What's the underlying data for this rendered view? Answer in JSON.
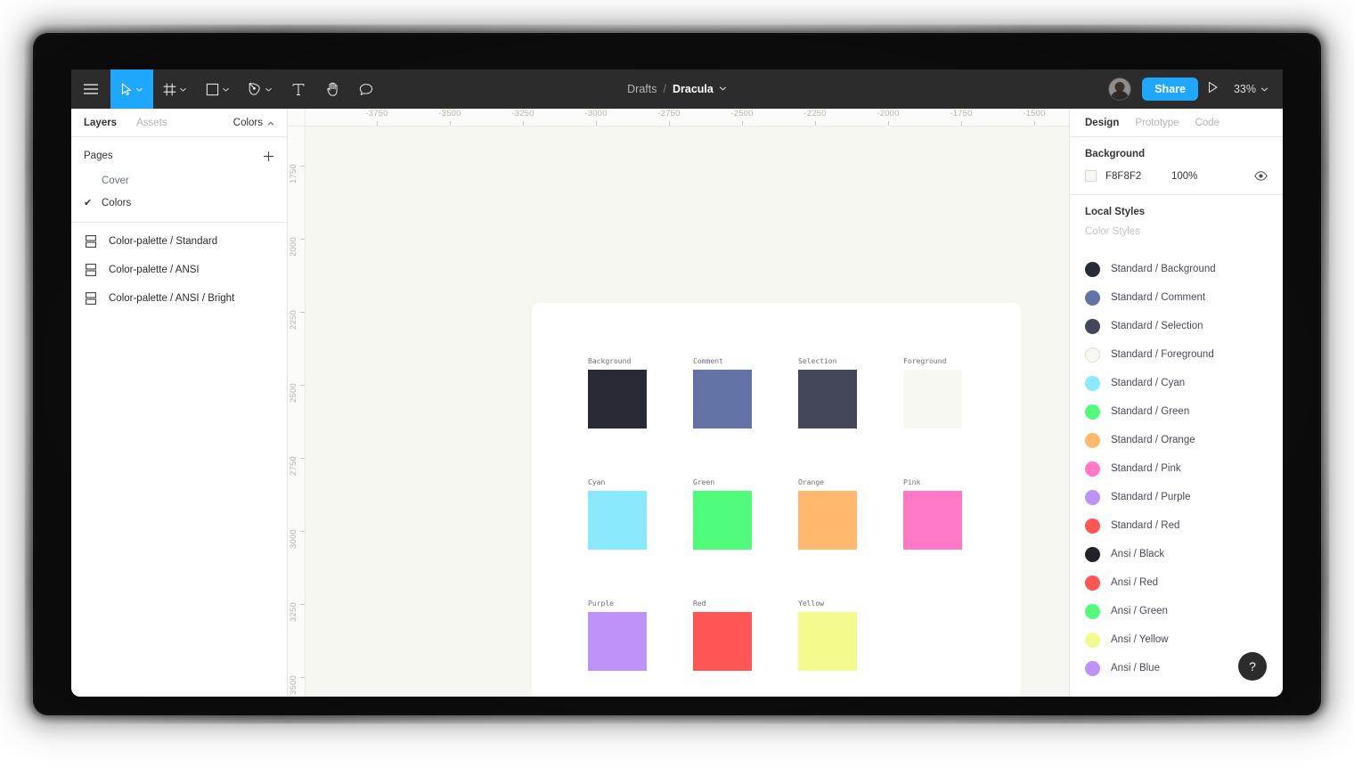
{
  "app": {
    "zoom_level": "33%"
  },
  "toolbar": {
    "menu_icon": "hamburger-menu-icon",
    "tools": [
      {
        "name": "move-tool",
        "icon": "cursor-arrow-icon",
        "has_caret": true,
        "active": true
      },
      {
        "name": "frame-tool",
        "icon": "frame-grid-icon",
        "has_caret": true,
        "active": false
      },
      {
        "name": "shape-tool",
        "icon": "square-icon",
        "has_caret": true,
        "active": false
      },
      {
        "name": "pen-tool",
        "icon": "pen-nib-icon",
        "has_caret": true,
        "active": false
      },
      {
        "name": "text-tool",
        "icon": "text-t-icon",
        "has_caret": false,
        "active": false
      },
      {
        "name": "hand-tool",
        "icon": "hand-icon",
        "has_caret": false,
        "active": false
      },
      {
        "name": "comment-tool",
        "icon": "comment-bubble-icon",
        "has_caret": false,
        "active": false
      }
    ],
    "breadcrumb": {
      "parent": "Drafts",
      "separator": "/",
      "file": "Dracula",
      "caret": "⌄"
    },
    "share_label": "Share",
    "present_icon": "play-triangle-icon",
    "avatar_name": "user-avatar"
  },
  "left_panel": {
    "tabs": [
      {
        "label": "Layers",
        "active": true
      },
      {
        "label": "Assets",
        "active": false
      }
    ],
    "right_tab": {
      "label": "Colors",
      "icon": "chevron-up-icon"
    },
    "pages_title": "Pages",
    "add_page_icon": "plus-icon",
    "pages": [
      {
        "label": "Cover",
        "selected": false,
        "tick": ""
      },
      {
        "label": "Colors",
        "selected": true,
        "tick": "✔"
      }
    ],
    "layers": [
      {
        "label": "Color-palette / Standard",
        "icon": "component-set-icon"
      },
      {
        "label": "Color-palette / ANSI",
        "icon": "component-set-icon"
      },
      {
        "label": "Color-palette / ANSI / Bright",
        "icon": "component-set-icon"
      }
    ]
  },
  "canvas": {
    "background_color": "#F6F6F1",
    "frame_color": "#FFFFFF",
    "ruler_h_ticks": [
      "-3750",
      "-3500",
      "-3250",
      "-3000",
      "-2750",
      "-2500",
      "-2250",
      "-2000",
      "-1750",
      "-1500"
    ],
    "ruler_v_ticks": [
      "1750",
      "2000",
      "2250",
      "2500",
      "2750",
      "3000",
      "3250",
      "3500"
    ],
    "swatches": [
      {
        "label": "Background",
        "color": "#282A36",
        "row": 0,
        "col": 0
      },
      {
        "label": "Comment",
        "color": "#6272A4",
        "row": 0,
        "col": 1
      },
      {
        "label": "Selection",
        "color": "#44475A",
        "row": 0,
        "col": 2
      },
      {
        "label": "Foreground",
        "color": "#F8F8F2",
        "row": 0,
        "col": 3
      },
      {
        "label": "Cyan",
        "color": "#8BE9FD",
        "row": 1,
        "col": 0
      },
      {
        "label": "Green",
        "color": "#50FA7B",
        "row": 1,
        "col": 1
      },
      {
        "label": "Orange",
        "color": "#FFB86C",
        "row": 1,
        "col": 2
      },
      {
        "label": "Pink",
        "color": "#FF79C6",
        "row": 1,
        "col": 3
      },
      {
        "label": "Purple",
        "color": "#BD93F9",
        "row": 2,
        "col": 0
      },
      {
        "label": "Red",
        "color": "#FF5555",
        "row": 2,
        "col": 1
      },
      {
        "label": "Yellow",
        "color": "#F1FA8C",
        "row": 2,
        "col": 2
      }
    ]
  },
  "right_panel": {
    "tabs": [
      {
        "label": "Design",
        "active": true
      },
      {
        "label": "Prototype",
        "active": false
      },
      {
        "label": "Code",
        "active": false
      }
    ],
    "background": {
      "title": "Background",
      "hex": "F8F8F2",
      "opacity": "100%",
      "swatch_color": "#F8F8F2",
      "visibility_icon": "eye-icon"
    },
    "local_styles": {
      "title": "Local Styles",
      "subtitle": "Color Styles",
      "styles": [
        {
          "label": "Standard / Background",
          "color": "#282A36"
        },
        {
          "label": "Standard / Comment",
          "color": "#6272A4"
        },
        {
          "label": "Standard / Selection",
          "color": "#44475A"
        },
        {
          "label": "Standard / Foreground",
          "color": "#F8F8F2"
        },
        {
          "label": "Standard / Cyan",
          "color": "#8BE9FD"
        },
        {
          "label": "Standard / Green",
          "color": "#50FA7B"
        },
        {
          "label": "Standard / Orange",
          "color": "#FFB86C"
        },
        {
          "label": "Standard / Pink",
          "color": "#FF79C6"
        },
        {
          "label": "Standard / Purple",
          "color": "#BD93F9"
        },
        {
          "label": "Standard / Red",
          "color": "#FF5555"
        },
        {
          "label": "Ansi / Black",
          "color": "#21222C"
        },
        {
          "label": "Ansi / Red",
          "color": "#FF5555"
        },
        {
          "label": "Ansi / Green",
          "color": "#50FA7B"
        },
        {
          "label": "Ansi / Yellow",
          "color": "#F1FA8C"
        },
        {
          "label": "Ansi / Blue",
          "color": "#BD93F9"
        }
      ]
    }
  },
  "help_button": {
    "label": "?"
  },
  "colors": {
    "accent": "#1EA7FD",
    "toolbar_bg": "#2C2C2C",
    "panel_bg": "#FFFFFF",
    "canvas_bg": "#F6F6F1"
  }
}
